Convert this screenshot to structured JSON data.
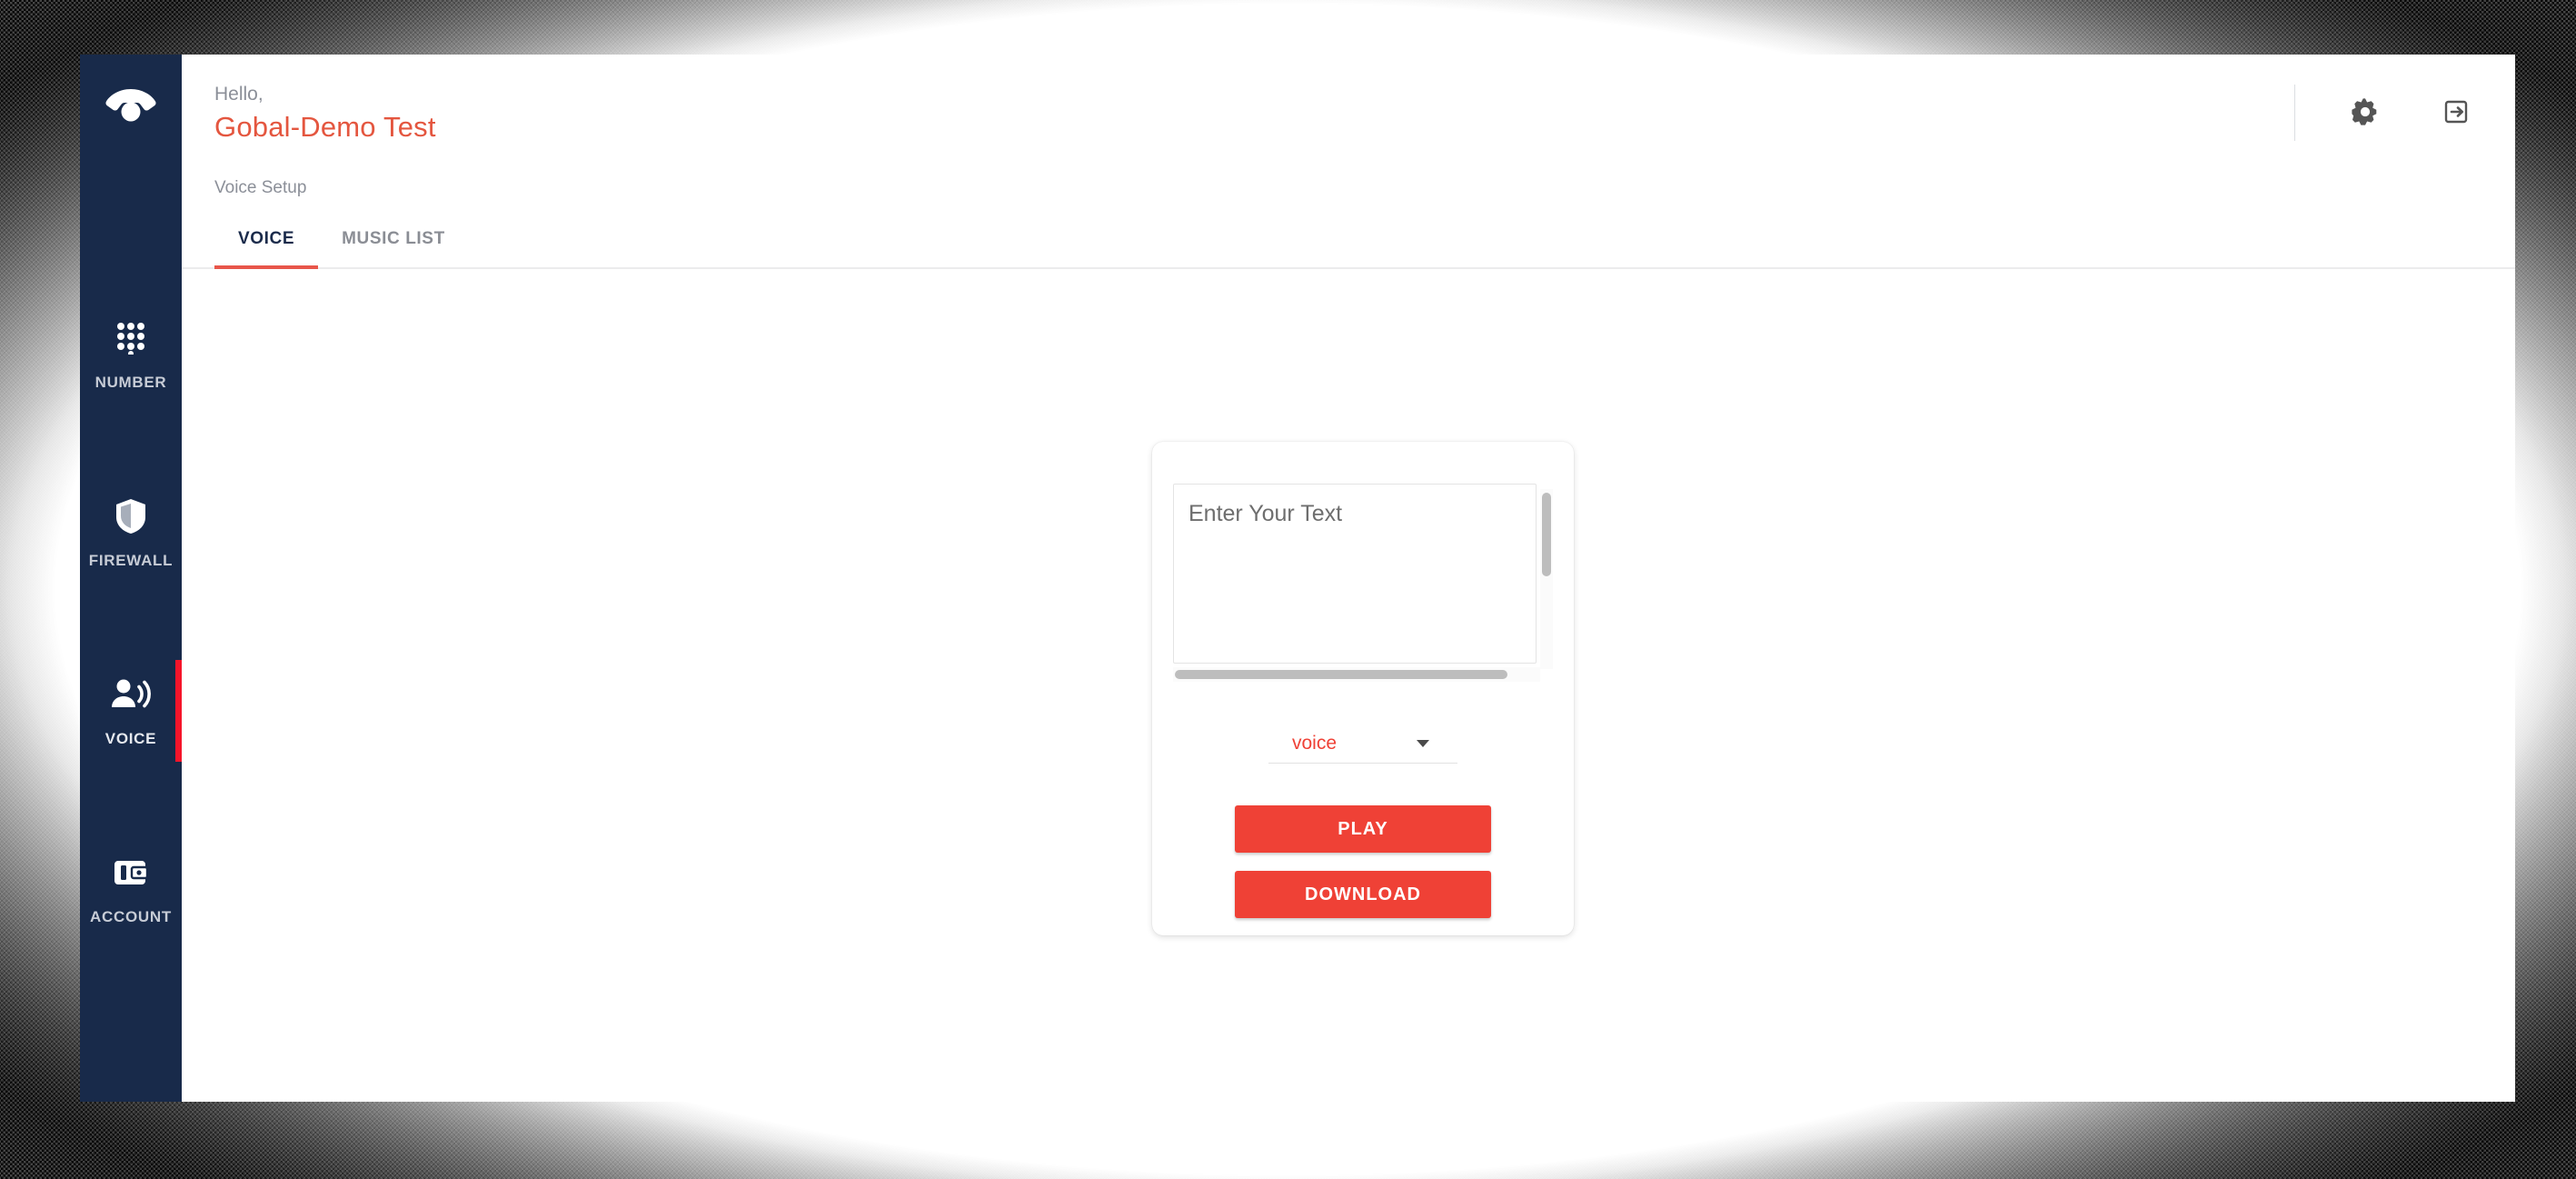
{
  "brand": {
    "logo_icon": "phone-handset-icon"
  },
  "header": {
    "hello_label": "Hello,",
    "account_name": "Gobal-Demo Test",
    "settings_icon": "gear-icon",
    "logout_icon": "logout-icon"
  },
  "sidebar": {
    "items": [
      {
        "label": "NUMBER",
        "icon": "dialpad-icon",
        "active": false
      },
      {
        "label": "FIREWALL",
        "icon": "shield-icon",
        "active": false
      },
      {
        "label": "VOICE",
        "icon": "voice-person-icon",
        "active": true
      },
      {
        "label": "ACCOUNT",
        "icon": "wallet-icon",
        "active": false
      }
    ]
  },
  "page": {
    "breadcrumb": "Voice Setup",
    "tabs": [
      {
        "label": "VOICE",
        "active": true
      },
      {
        "label": "MUSIC LIST",
        "active": false
      }
    ]
  },
  "card": {
    "text_input_placeholder": "Enter Your Text",
    "text_input_value": "",
    "voice_select_value": "voice",
    "voice_select_caret_icon": "caret-down-icon",
    "play_label": "PLAY",
    "download_label": "DOWNLOAD"
  },
  "colors": {
    "sidebar_bg": "#182a4a",
    "accent_red": "#ef4136",
    "active_indicator": "#f5142a",
    "tab_active_text": "#1b2b4b",
    "greeting_name": "#e4563f"
  }
}
